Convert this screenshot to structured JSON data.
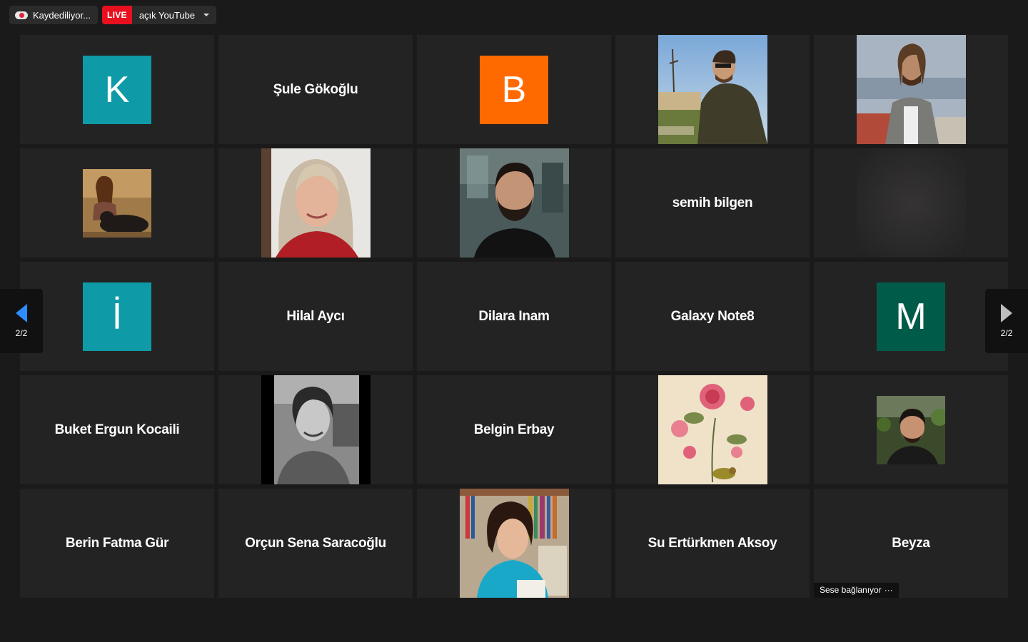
{
  "topbar": {
    "recording_label": "Kaydediliyor...",
    "live_badge": "LIVE",
    "live_label": "açık YouTube"
  },
  "navigation": {
    "prev_page_label": "2/2",
    "next_page_label": "2/2"
  },
  "tiles": [
    {
      "type": "avatar",
      "letter": "K",
      "color": "#0e9aa7"
    },
    {
      "type": "name",
      "name": "Şule Gökoğlu"
    },
    {
      "type": "avatar",
      "letter": "B",
      "color": "#ff6a00"
    },
    {
      "type": "photo",
      "photo": "man-sunglasses-jacket-outdoor-photo"
    },
    {
      "type": "photo",
      "photo": "man-long-hair-scarf-city-view-photo"
    },
    {
      "type": "photo",
      "photo": "woman-with-dog-small-photo"
    },
    {
      "type": "photo",
      "photo": "blonde-woman-smiling-photo"
    },
    {
      "type": "photo",
      "photo": "bearded-man-black-shirt-photo"
    },
    {
      "type": "name",
      "name": "semih bilgen"
    },
    {
      "type": "photo",
      "photo": "dark-fabric-texture-photo"
    },
    {
      "type": "avatar",
      "letter": "İ",
      "color": "#0e9aa7"
    },
    {
      "type": "name",
      "name": "Hilal Aycı"
    },
    {
      "type": "name",
      "name": "Dilara Inam"
    },
    {
      "type": "name",
      "name": "Galaxy Note8"
    },
    {
      "type": "avatar",
      "letter": "M",
      "color": "#005c48"
    },
    {
      "type": "name",
      "name": "Buket Ergun Kocaili"
    },
    {
      "type": "photo",
      "photo": "black-white-woman-video-photo"
    },
    {
      "type": "name",
      "name": "Belgin Erbay"
    },
    {
      "type": "photo",
      "photo": "floral-painting-bird-photo"
    },
    {
      "type": "photo",
      "photo": "man-smiling-small-photo"
    },
    {
      "type": "name",
      "name": "Berin Fatma Gür"
    },
    {
      "type": "name",
      "name": "Orçun Sena Saracoğlu"
    },
    {
      "type": "photo",
      "photo": "woman-curly-hair-bookshelf-photo"
    },
    {
      "type": "name",
      "name": "Su Ertürkmen Aksoy"
    },
    {
      "type": "name",
      "name": "Beyza",
      "status": "Sese bağlanıyor"
    }
  ]
}
